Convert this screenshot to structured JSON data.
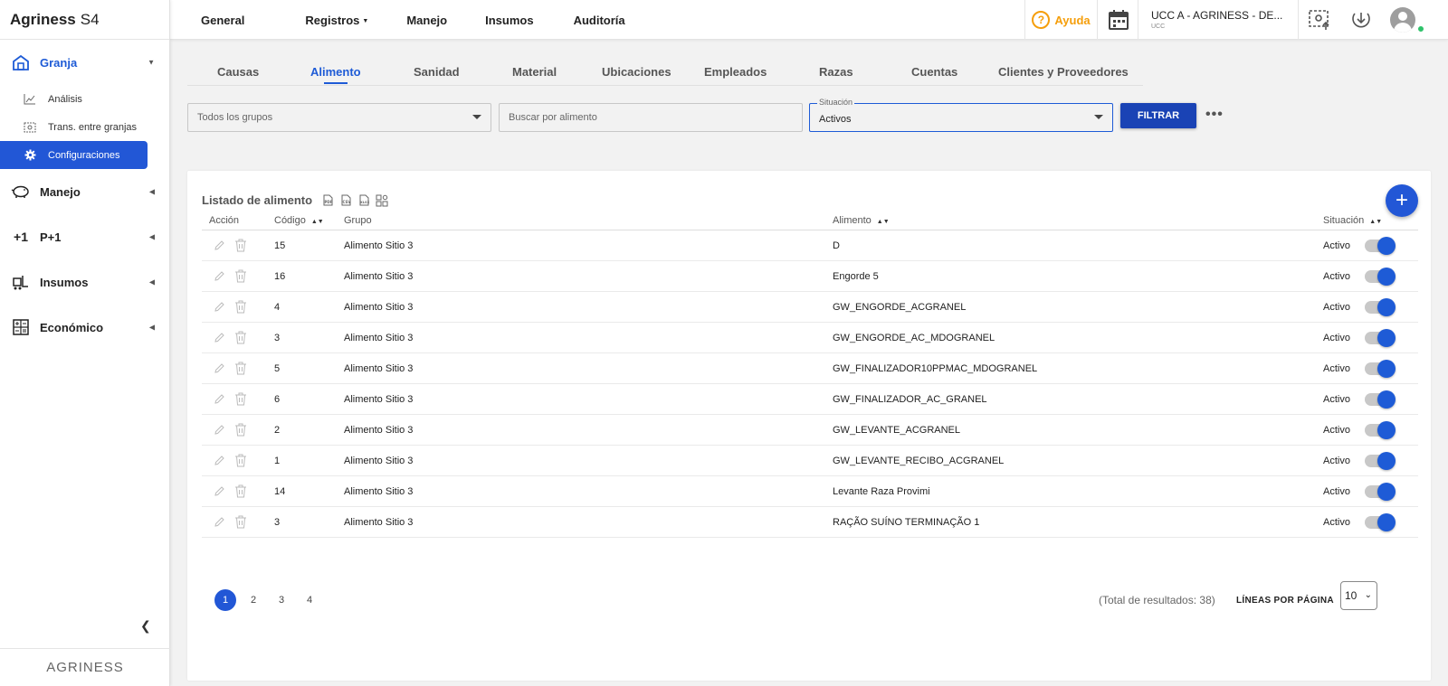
{
  "app": {
    "brand": "Agriness",
    "brand_suffix": "S4",
    "footer_logo": "AGRINESS"
  },
  "sidebar": {
    "groups": [
      {
        "label": "Granja",
        "icon": "barn-icon",
        "active": true
      },
      {
        "label": "Manejo",
        "icon": "pig-icon"
      },
      {
        "label": "P+1",
        "icon": "plus-one-icon"
      },
      {
        "label": "Insumos",
        "icon": "forklift-icon"
      },
      {
        "label": "Económico",
        "icon": "calculator-icon"
      }
    ],
    "subitems": [
      {
        "label": "Análisis",
        "icon": "chart-line-icon"
      },
      {
        "label": "Trans. entre granjas",
        "icon": "transfer-icon"
      },
      {
        "label": "Configuraciones",
        "icon": "gear-icon",
        "active": true
      }
    ]
  },
  "topnav": {
    "items": [
      "General",
      "Registros",
      "Manejo",
      "Insumos",
      "Auditoría"
    ],
    "help_label": "Ayuda",
    "farm_name": "UCC A - AGRINESS - DE...",
    "farm_sub": "UCC"
  },
  "tabs": [
    "Causas",
    "Alimento",
    "Sanidad",
    "Material",
    "Ubicaciones",
    "Empleados",
    "Razas",
    "Cuentas",
    "Clientes y Proveedores"
  ],
  "active_tab": "Alimento",
  "filters": {
    "group_placeholder": "Todos los grupos",
    "search_placeholder": "Buscar por alimento",
    "situation_label": "Situación",
    "situation_value": "Activos",
    "filter_button": "FILTRAR",
    "more": "•••"
  },
  "list": {
    "title": "Listado de alimento",
    "columns": {
      "accion": "Acción",
      "codigo": "Código",
      "grupo": "Grupo",
      "alimento": "Alimento",
      "situacion": "Situación"
    },
    "rows": [
      {
        "codigo": "15",
        "grupo": "Alimento Sitio 3",
        "alimento": "D",
        "situacion": "Activo"
      },
      {
        "codigo": "16",
        "grupo": "Alimento Sitio 3",
        "alimento": "Engorde 5",
        "situacion": "Activo"
      },
      {
        "codigo": "4",
        "grupo": "Alimento Sitio 3",
        "alimento": "GW_ENGORDE_ACGRANEL",
        "situacion": "Activo"
      },
      {
        "codigo": "3",
        "grupo": "Alimento Sitio 3",
        "alimento": "GW_ENGORDE_AC_MDOGRANEL",
        "situacion": "Activo"
      },
      {
        "codigo": "5",
        "grupo": "Alimento Sitio 3",
        "alimento": "GW_FINALIZADOR10PPMAC_MDOGRANEL",
        "situacion": "Activo"
      },
      {
        "codigo": "6",
        "grupo": "Alimento Sitio 3",
        "alimento": "GW_FINALIZADOR_AC_GRANEL",
        "situacion": "Activo"
      },
      {
        "codigo": "2",
        "grupo": "Alimento Sitio 3",
        "alimento": "GW_LEVANTE_ACGRANEL",
        "situacion": "Activo"
      },
      {
        "codigo": "1",
        "grupo": "Alimento Sitio 3",
        "alimento": "GW_LEVANTE_RECIBO_ACGRANEL",
        "situacion": "Activo"
      },
      {
        "codigo": "14",
        "grupo": "Alimento Sitio 3",
        "alimento": "Levante Raza Provimi",
        "situacion": "Activo"
      },
      {
        "codigo": "3",
        "grupo": "Alimento Sitio 3",
        "alimento": "RAÇÃO SUÍNO TERMINAÇÃO 1",
        "situacion": "Activo"
      }
    ]
  },
  "pagination": {
    "pages": [
      "1",
      "2",
      "3",
      "4"
    ],
    "current": "1",
    "total": "(Total de resultados: 38)",
    "lines_label": "LÍNEAS POR PÁGINA",
    "lines_value": "10"
  },
  "colors": {
    "primary": "#1e5bd6",
    "help": "#f59e0b",
    "online": "#2ec26a"
  }
}
